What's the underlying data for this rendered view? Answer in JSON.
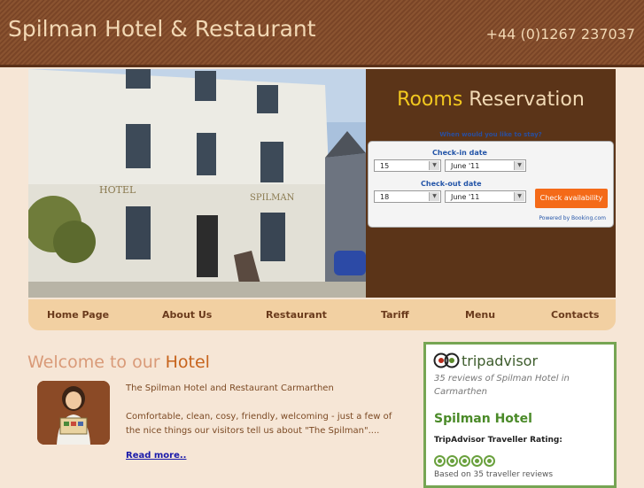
{
  "header": {
    "site_title": "Spilman Hotel & Restaurant",
    "phone": "+44 (0)1267 237037"
  },
  "hero": {
    "alt": "Spilman Hotel building"
  },
  "reservation": {
    "title_accent": "Rooms",
    "title_rest": " Reservation",
    "subtitle": "When would you like to stay?",
    "checkin_label": "Check-in date",
    "checkin_day": "15",
    "checkin_month": "June '11",
    "checkout_label": "Check-out date",
    "checkout_day": "18",
    "checkout_month": "June '11",
    "check_button": "Check availability",
    "powered": "Powered by Booking.com"
  },
  "nav": {
    "items": [
      {
        "label": "Home Page"
      },
      {
        "label": "About Us"
      },
      {
        "label": "Restaurant"
      },
      {
        "label": "Tariff"
      },
      {
        "label": "Menu"
      },
      {
        "label": "Contacts"
      }
    ]
  },
  "welcome": {
    "heading_prefix": "Welcome to our ",
    "heading_accent": "Hotel",
    "intro_title": "The Spilman Hotel and Restaurant Carmarthen",
    "intro_text": "Comfortable, clean, cosy, friendly, welcoming - just a few of the nice things our visitors tell us about \"The Spilman\"....",
    "read_more": "Read more.."
  },
  "tripadvisor": {
    "logo_text": "tripadvisor",
    "reviews": "35 reviews of Spilman Hotel in Carmarthen",
    "hotel_name": "Spilman Hotel",
    "rating_label": "TripAdvisor Traveller Rating:",
    "rating": 4.5,
    "rating_max": 5,
    "based_on": "Based on 35 traveller reviews"
  },
  "colors": {
    "header_brown": "#7a4527",
    "panel_brown": "#5b3418",
    "accent_yellow": "#f2c81f",
    "accent_orange": "#c7641d",
    "ta_green": "#76a553",
    "button_orange": "#f46a18"
  }
}
